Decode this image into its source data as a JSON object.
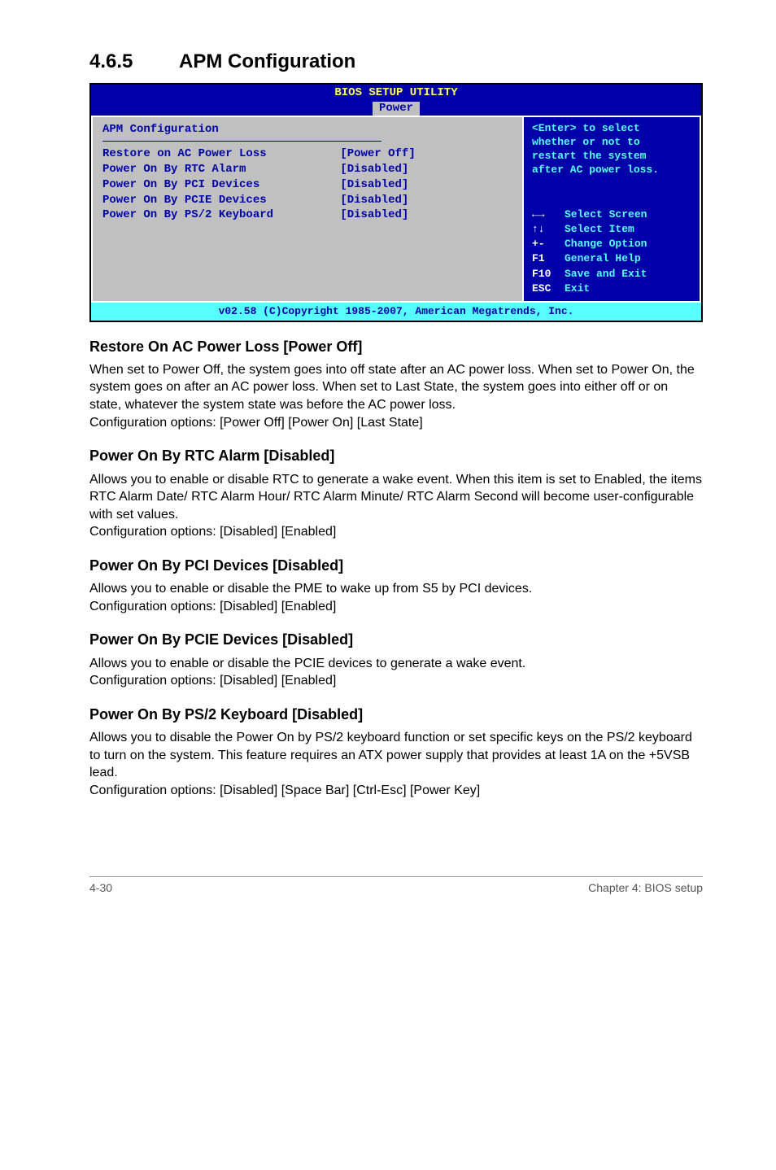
{
  "section": {
    "number": "4.6.5",
    "title": "APM Configuration"
  },
  "bios": {
    "header": "BIOS SETUP UTILITY",
    "tab": "Power",
    "panel_title": "APM Configuration",
    "rows": [
      {
        "label": "Restore on AC Power Loss",
        "value": "[Power Off]"
      },
      {
        "label": "Power On By RTC Alarm",
        "value": "[Disabled]"
      },
      {
        "label": "Power On By PCI Devices",
        "value": "[Disabled]"
      },
      {
        "label": "Power On By PCIE Devices",
        "value": "[Disabled]"
      },
      {
        "label": "Power On By PS/2 Keyboard",
        "value": "[Disabled]"
      }
    ],
    "right_help": "<Enter> to select\nwhether or not to\nrestart the system\nafter AC power loss.",
    "nav": [
      {
        "key": "←→",
        "desc": "Select Screen"
      },
      {
        "key": "↑↓",
        "desc": "Select Item"
      },
      {
        "key": "+-",
        "desc": "Change Option"
      },
      {
        "key": "F1",
        "desc": "General Help"
      },
      {
        "key": "F10",
        "desc": "Save and Exit"
      },
      {
        "key": "ESC",
        "desc": "Exit"
      }
    ],
    "footer": "v02.58 (C)Copyright 1985-2007, American Megatrends, Inc."
  },
  "subsections": [
    {
      "heading": "Restore On AC Power Loss [Power Off]",
      "body": "When set to Power Off, the system goes into off state after an AC power loss. When set to Power On, the system goes on after an AC power loss. When set to Last State, the system goes into either off or on state, whatever the system state was before the AC power loss.\nConfiguration options: [Power Off] [Power On] [Last State]"
    },
    {
      "heading": "Power On By RTC Alarm [Disabled]",
      "body": "Allows you to enable or disable RTC to generate a wake event. When this item is set to Enabled, the items RTC Alarm Date/ RTC Alarm Hour/ RTC Alarm Minute/ RTC Alarm Second will become user-configurable with set values.\nConfiguration options: [Disabled] [Enabled]"
    },
    {
      "heading": "Power On By PCI Devices [Disabled]",
      "body": "Allows you to enable or disable the PME to wake up from S5 by PCI devices.\nConfiguration options: [Disabled] [Enabled]"
    },
    {
      "heading": "Power On By PCIE Devices [Disabled]",
      "body": "Allows you to enable or disable the PCIE devices to generate a wake event.\nConfiguration options: [Disabled] [Enabled]"
    },
    {
      "heading": "Power On By PS/2 Keyboard [Disabled]",
      "body": "Allows you to disable the Power On by PS/2 keyboard function or set specific keys on the PS/2 keyboard to turn on the system. This feature requires an ATX power supply that provides at least 1A on the +5VSB lead.\nConfiguration options: [Disabled] [Space Bar] [Ctrl-Esc] [Power Key]"
    }
  ],
  "page_footer": {
    "left": "4-30",
    "right": "Chapter 4: BIOS setup"
  }
}
